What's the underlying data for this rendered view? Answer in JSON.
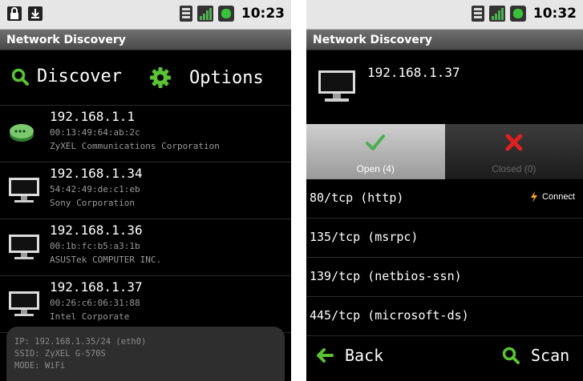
{
  "left_screen": {
    "status": {
      "time": "10:23"
    },
    "app_title": "Network Discovery",
    "menu": {
      "discover_label": "Discover",
      "options_label": "Options"
    },
    "hosts": [
      {
        "ip": "192.168.1.1",
        "mac": "00:13:49:64:ab:2c",
        "vendor": "ZyXEL Communications Corporation",
        "icon": "router-icon"
      },
      {
        "ip": "192.168.1.34",
        "mac": "54:42:49:de:c1:eb",
        "vendor": "Sony Corporation",
        "icon": "computer-icon"
      },
      {
        "ip": "192.168.1.36",
        "mac": "00:1b:fc:b5:a3:1b",
        "vendor": "ASUSTek COMPUTER INC.",
        "icon": "computer-icon"
      },
      {
        "ip": "192.168.1.37",
        "mac": "00:26:c6:06:31:88",
        "vendor": "Intel Corporate",
        "icon": "computer-icon"
      }
    ],
    "network_info": {
      "ip": "IP: 192.168.1.35/24 (eth0)",
      "ssid": "SSID: ZyXEL G-570S",
      "mode": "MODE: WiFi"
    }
  },
  "right_screen": {
    "status": {
      "time": "10:32"
    },
    "app_title": "Network Discovery",
    "host_ip": "192.168.1.37",
    "tabs": [
      {
        "label": "Open (4)",
        "active": true
      },
      {
        "label": "Closed (0)",
        "active": false
      }
    ],
    "ports": [
      {
        "label": "80/tcp (http)",
        "action": "Connect"
      },
      {
        "label": "135/tcp (msrpc)"
      },
      {
        "label": "139/tcp (netbios-ssn)"
      },
      {
        "label": "445/tcp (microsoft-ds)"
      }
    ],
    "bottom": {
      "back_label": "Back",
      "scan_label": "Scan"
    }
  },
  "colors": {
    "accent_green": "#4caf50",
    "close_red": "#e02020",
    "connect_orange": "#f5a623"
  }
}
